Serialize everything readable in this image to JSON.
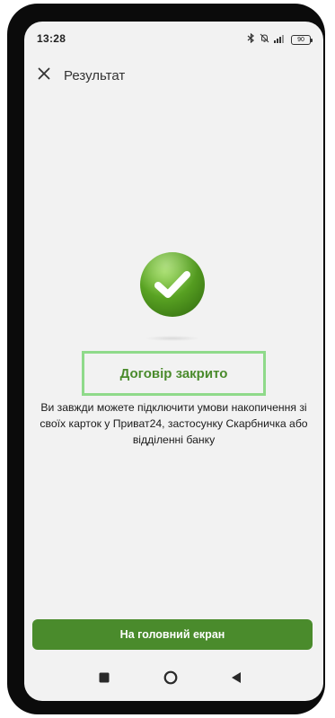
{
  "status_bar": {
    "time": "13:28",
    "battery": "90",
    "icons": [
      "bluetooth-icon",
      "bell-off-icon",
      "signal-icon",
      "battery-icon"
    ]
  },
  "header": {
    "close_icon": "close-icon",
    "title": "Результат"
  },
  "result": {
    "icon": "check-circle-icon",
    "title": "Договір закрито",
    "description": "Ви завжди можете підключити умови накопичення зі своїх карток у Приват24, застосунку Скарбничка або відділенні банку"
  },
  "actions": {
    "home_button_label": "На головний екран"
  },
  "nav_bar": {
    "items": [
      "square-nav-icon",
      "circle-nav-icon",
      "back-triangle-icon"
    ]
  },
  "colors": {
    "accent": "#4a8b2c",
    "highlight_border": "#8fda8a",
    "background": "#f2f2f2"
  }
}
